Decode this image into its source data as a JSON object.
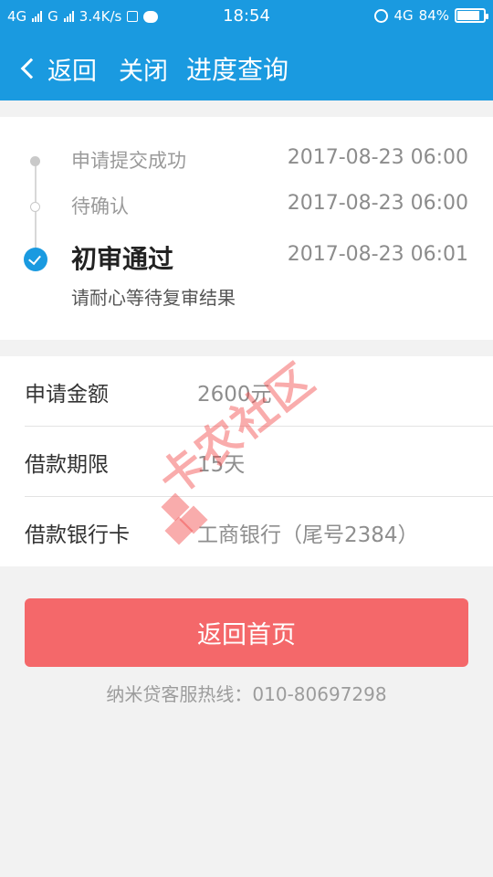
{
  "status_bar": {
    "network1": "4G",
    "network2": "G",
    "speed": "3.4K/s",
    "time": "18:54",
    "network3": "4G",
    "battery": "84%",
    "battery_level": 0.84
  },
  "nav": {
    "back_label": "返回",
    "close_label": "关闭",
    "title": "进度查询"
  },
  "timeline": [
    {
      "label": "申请提交成功",
      "time": "2017-08-23 06:00"
    },
    {
      "label": "待确认",
      "time": "2017-08-23 06:00"
    },
    {
      "label": "初审通过",
      "time": "2017-08-23 06:01",
      "sub": "请耐心等待复审结果"
    }
  ],
  "info": [
    {
      "key": "申请金额",
      "value": "2600元"
    },
    {
      "key": "借款期限",
      "value": "15天"
    },
    {
      "key": "借款银行卡",
      "value": "工商银行（尾号2384）"
    }
  ],
  "watermark": "卡农社区",
  "home_button": "返回首页",
  "hotline": "纳米贷客服热线：010-80697298",
  "colors": {
    "header": "#1a9ae0",
    "button": "#f4686a",
    "check": "#1a9ae0"
  }
}
